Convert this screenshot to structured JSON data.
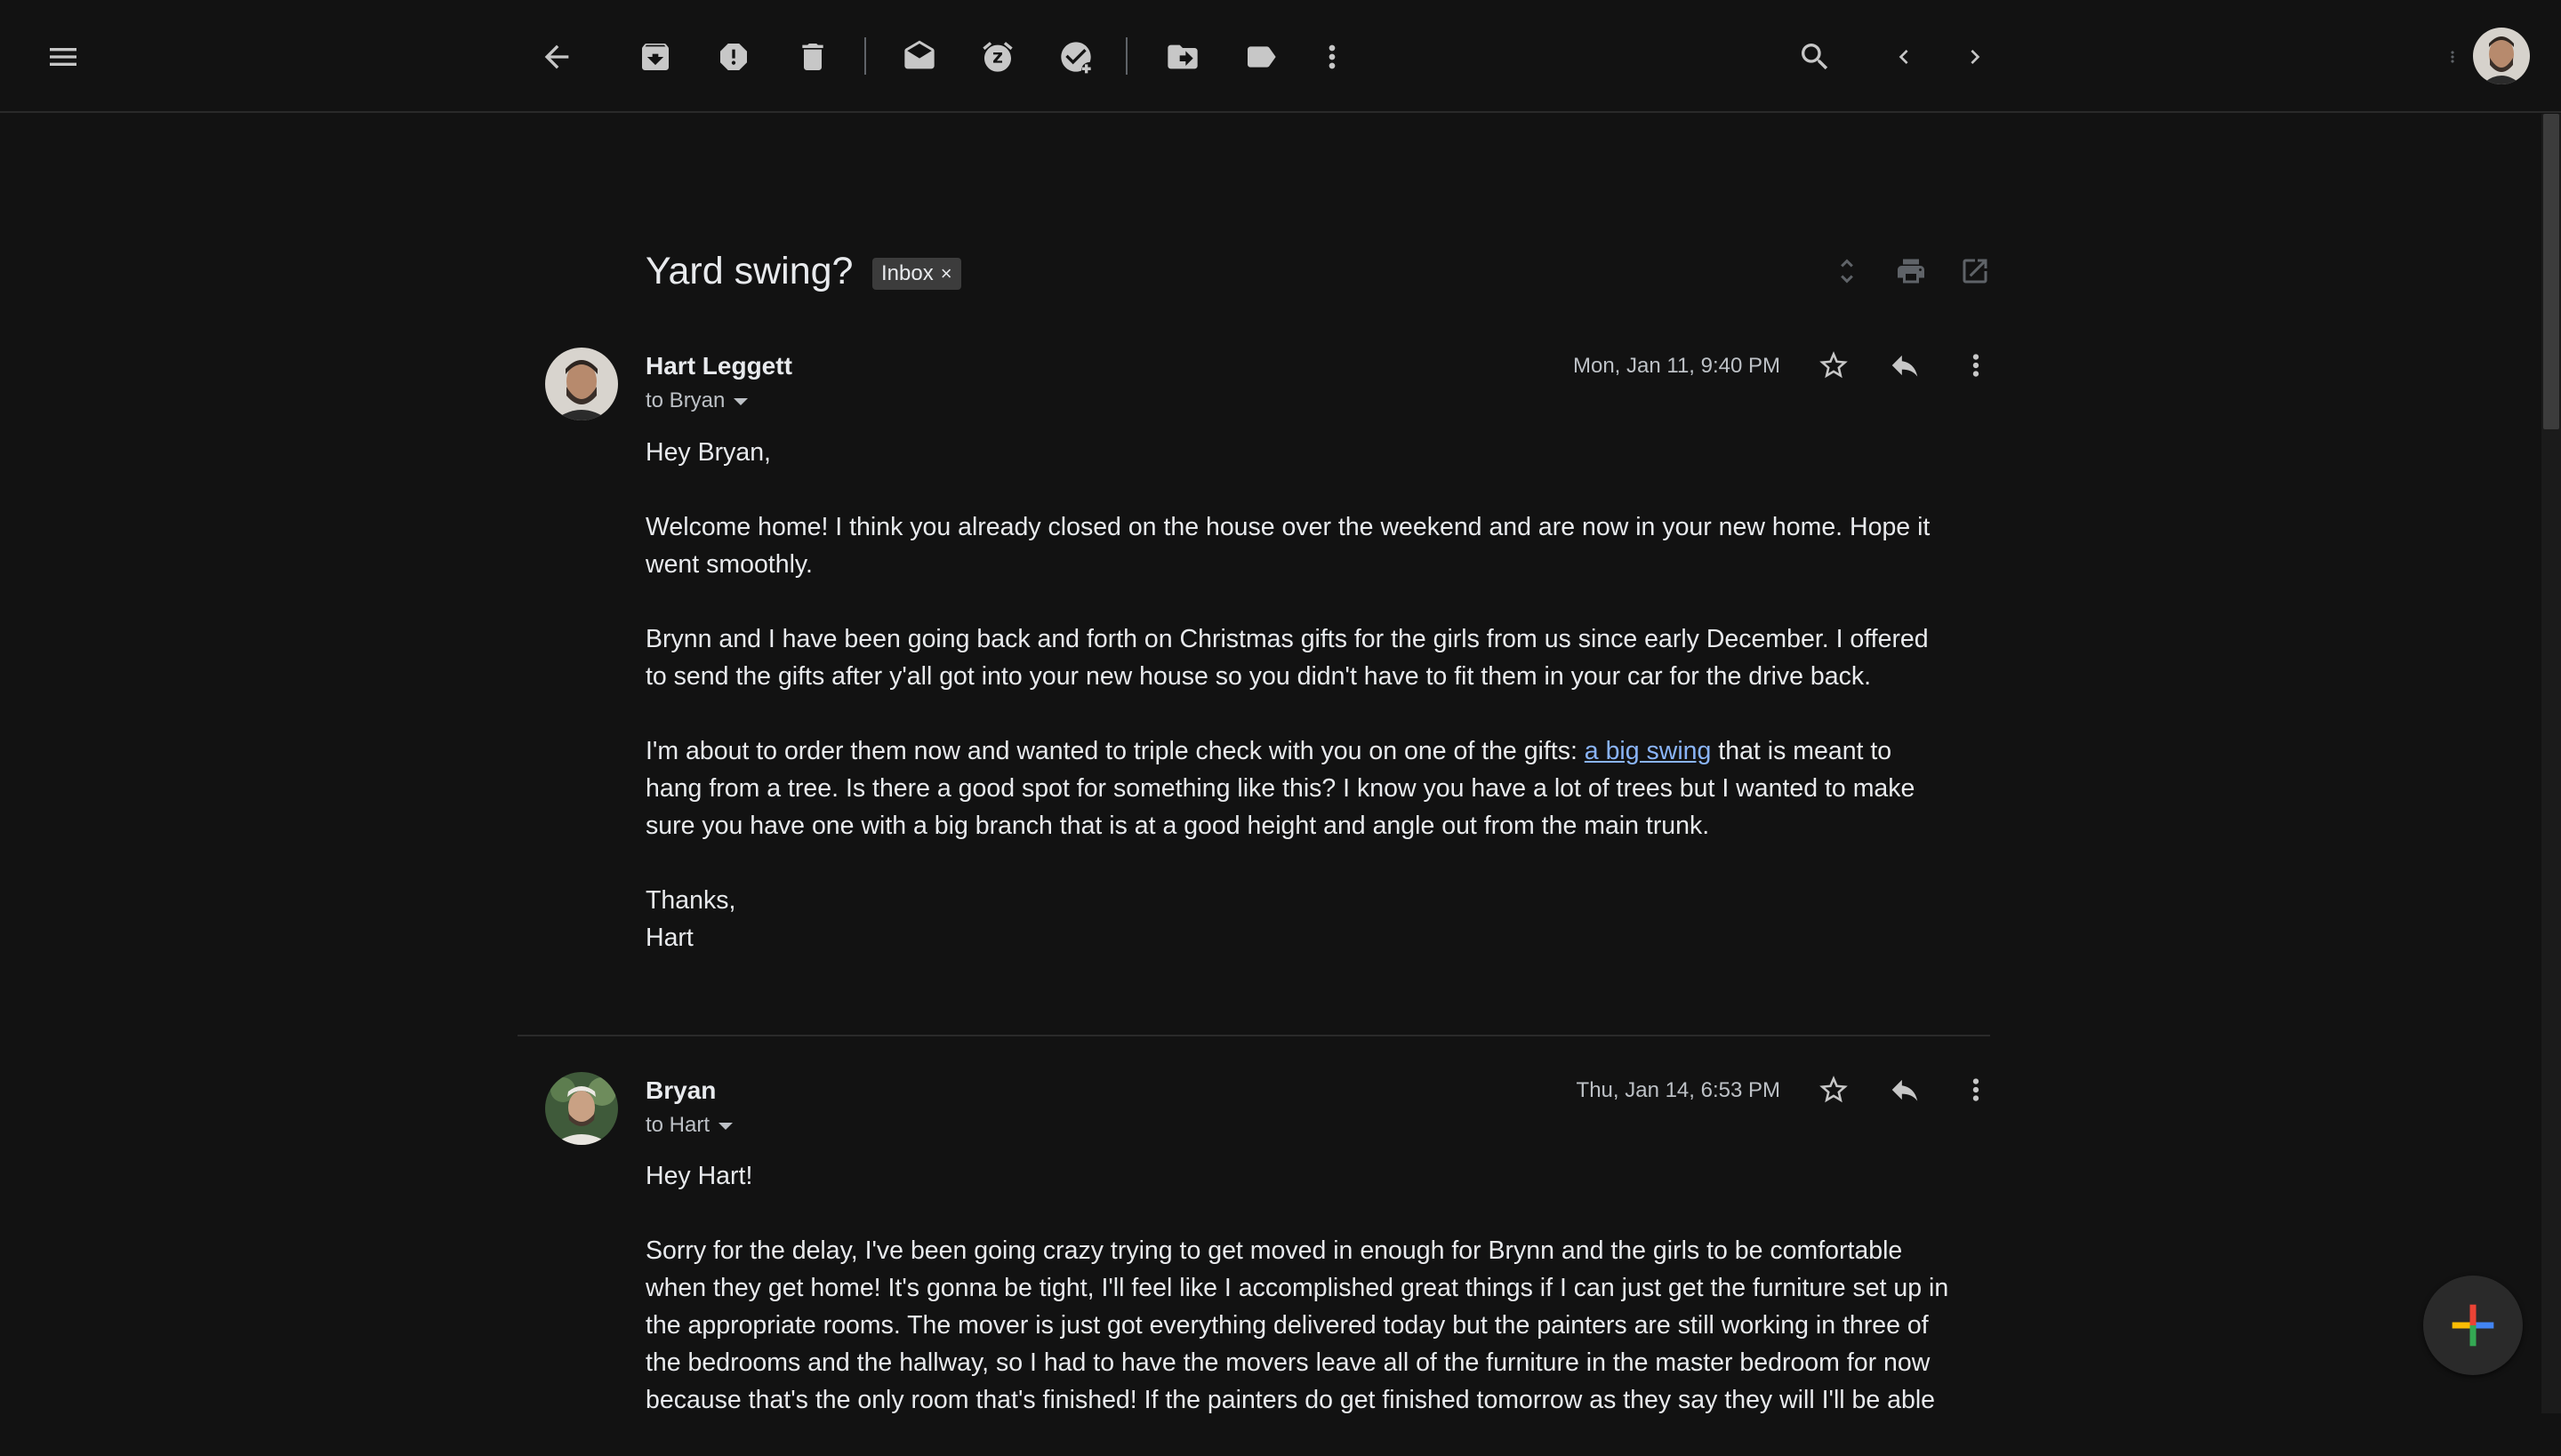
{
  "toolbar": {
    "menu_icon": "menu-icon",
    "back_icon": "arrow-back-icon",
    "archive_icon": "archive-icon",
    "spam_icon": "report-spam-icon",
    "delete_icon": "trash-icon",
    "mark_unread_icon": "mark-unread-icon",
    "snooze_icon": "snooze-icon",
    "add_task_icon": "add-task-icon",
    "move_icon": "move-to-icon",
    "label_icon": "label-icon",
    "more_icon": "more-vert-icon",
    "search_icon": "search-icon",
    "prev_icon": "chevron-left-icon",
    "next_icon": "chevron-right-icon"
  },
  "thread": {
    "subject": "Yard swing?",
    "label": "Inbox",
    "label_remove": "×"
  },
  "messages": [
    {
      "sender": "Hart Leggett",
      "recipient": "to Bryan",
      "date": "Mon, Jan 11, 9:40 PM",
      "greeting": "Hey Bryan,",
      "p1": "Welcome home! I think you already closed on the house over the weekend and are now in your new home. Hope it went smoothly.",
      "p2": "Brynn and I have been going back and forth on Christmas gifts for the girls from us since early December. I offered to send the gifts after y'all got into your new house so you didn't have to fit them in your car for the drive back.",
      "p3_before": "I'm about to order them now and wanted to triple check with you on one of the gifts: ",
      "p3_link": "a big swing",
      "p3_after": " that is meant to hang from a tree. Is there a good spot for something like this? I know you have a lot of trees but I wanted to make sure you have one with a big branch that is at a good height and angle out from the main trunk.",
      "signoff": "Thanks,",
      "signature": "Hart"
    },
    {
      "sender": "Bryan",
      "recipient": "to Hart",
      "date": "Thu, Jan 14, 6:53 PM",
      "greeting": "Hey Hart!",
      "p1": "Sorry for the delay, I've been going crazy trying to get moved in enough for Brynn and the girls to be comfortable when they get home! It's gonna be tight, I'll feel like I accomplished great things if I can just get the furniture set up in the appropriate rooms. The mover is just got everything delivered today but the painters are still working in three of the bedrooms and the hallway, so I had to have the movers leave all of the furniture in the master bedroom for now because that's the only room that's finished! If the painters do get finished tomorrow as they say they will I'll be able"
    }
  ],
  "colors": {
    "background": "#121212",
    "text": "#e8eaed",
    "secondary_text": "#bdc1c6",
    "link": "#8ab4f8",
    "chip": "#3c3c3c"
  }
}
